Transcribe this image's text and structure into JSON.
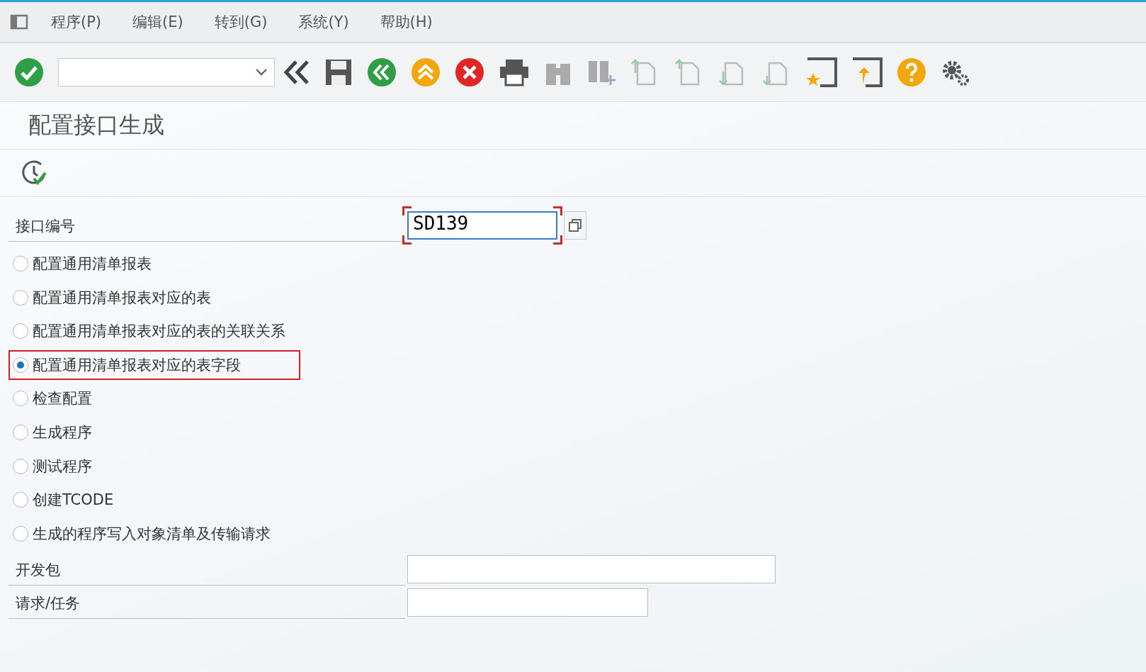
{
  "menu_bar": {
    "items": [
      "程序(P)",
      "编辑(E)",
      "转到(G)",
      "系统(Y)",
      "帮助(H)"
    ]
  },
  "title": "配置接口生成",
  "fields": [
    {
      "label": "接口编号",
      "value": "SD139",
      "focused": true
    }
  ],
  "options": [
    {
      "label": "配置通用清单报表",
      "selected": false
    },
    {
      "label": "配置通用清单报表对应的表",
      "selected": false
    },
    {
      "label": "配置通用清单报表对应的表的关联关系",
      "selected": false
    },
    {
      "label": "配置通用清单报表对应的表字段",
      "selected": true
    },
    {
      "label": "检查配置",
      "selected": false
    },
    {
      "label": "生成程序",
      "selected": false
    },
    {
      "label": "测试程序",
      "selected": false
    },
    {
      "label": "创建TCODE",
      "selected": false
    },
    {
      "label": "生成的程序写入对象清单及传输请求",
      "selected": false
    }
  ],
  "extra_fields": [
    {
      "label": "开发包"
    },
    {
      "label": "请求/任务"
    }
  ]
}
